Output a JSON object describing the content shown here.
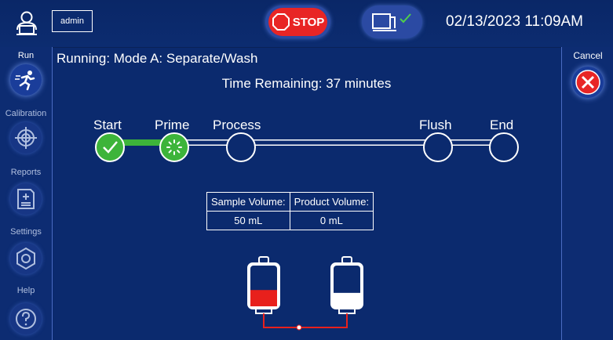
{
  "header": {
    "username": "admin",
    "stop_label": "STOP",
    "datetime": "02/13/2023 11:09AM",
    "icons": [
      "user-icon",
      "stop-octagon-icon",
      "device-status-icon",
      "checkmark-icon"
    ]
  },
  "nav": {
    "items": [
      {
        "label": "Run",
        "icon": "running-person-icon",
        "active": true
      },
      {
        "label": "Calibration",
        "icon": "crosshair-icon",
        "active": false
      },
      {
        "label": "Reports",
        "icon": "report-icon",
        "active": false
      },
      {
        "label": "Settings",
        "icon": "gear-icon",
        "active": false
      },
      {
        "label": "Help",
        "icon": "help-icon",
        "active": false
      }
    ]
  },
  "cancel": {
    "label": "Cancel",
    "icon": "close-icon"
  },
  "main": {
    "title": "Running: Mode A: Separate/Wash",
    "time_remaining": "Time Remaining: 37 minutes",
    "steps": [
      {
        "label": "Start",
        "state": "complete"
      },
      {
        "label": "Prime",
        "state": "in-progress"
      },
      {
        "label": "Process",
        "state": "pending"
      },
      {
        "label": "Flush",
        "state": "pending"
      },
      {
        "label": "End",
        "state": "pending"
      }
    ],
    "volume_table": {
      "headers": [
        "Sample Volume:",
        "Product Volume:"
      ],
      "values": [
        "50 mL",
        "0 mL"
      ]
    },
    "bags": {
      "sample_fill_fraction": 0.4,
      "product_fill_fraction": 0.33,
      "sample_color": "#e8201c",
      "product_color": "#ffffff"
    }
  },
  "colors": {
    "background": "#0b2a6e",
    "complete": "#3db43a",
    "stop": "#e82525",
    "cancel": "#e82525"
  }
}
